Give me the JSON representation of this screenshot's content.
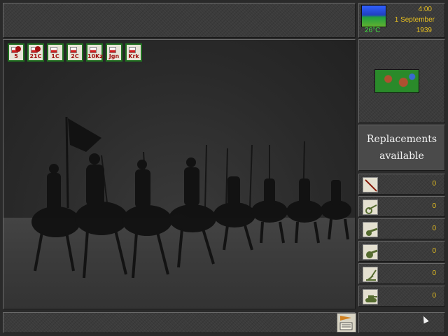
{
  "status": {
    "time": "4:00",
    "date": "1 September",
    "year": "1939",
    "temperature": "26°C",
    "weather_icon": "clear-sky-icon"
  },
  "units": [
    {
      "label": "5",
      "icon": "cavalry-unit-icon"
    },
    {
      "label": "21C",
      "icon": "cavalry-unit-icon"
    },
    {
      "label": "1C",
      "icon": "artillery-unit-icon"
    },
    {
      "label": "2C",
      "icon": "artillery-unit-icon"
    },
    {
      "label": "10Kz",
      "icon": "armor-unit-icon"
    },
    {
      "label": "Jgn",
      "icon": "infantry-unit-icon"
    },
    {
      "label": "Krk",
      "icon": "infantry-unit-icon"
    }
  ],
  "replacements": {
    "title_line1": "Replacements",
    "title_line2": "available",
    "items": [
      {
        "type": "infantry-rifle-icon",
        "count": "0"
      },
      {
        "type": "light-gun-icon",
        "count": "0"
      },
      {
        "type": "field-gun-icon",
        "count": "0"
      },
      {
        "type": "heavy-gun-icon",
        "count": "0"
      },
      {
        "type": "anti-aircraft-gun-icon",
        "count": "0"
      },
      {
        "type": "tank-icon",
        "count": "0"
      }
    ]
  },
  "colors": {
    "accent_text": "#e8c020",
    "temperature_text": "#40e040",
    "unit_border": "#207020",
    "panel_bg": "#3b3b3b"
  }
}
